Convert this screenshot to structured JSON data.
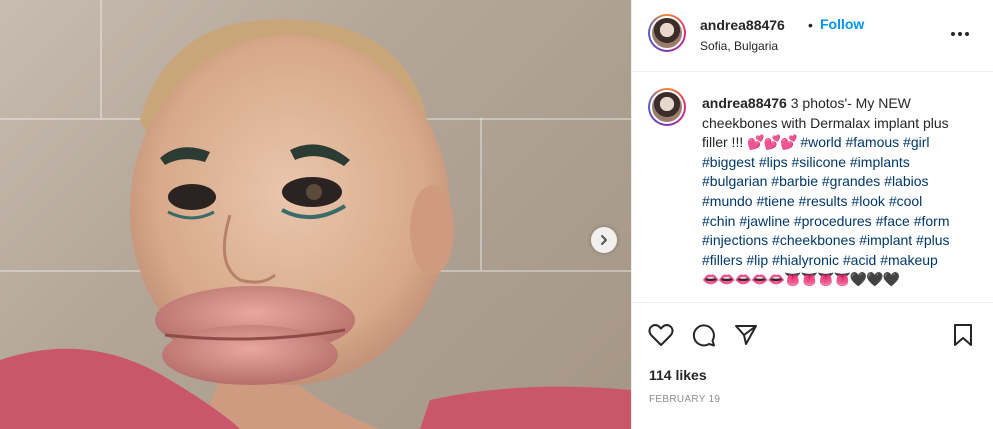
{
  "post": {
    "username": "andrea88476",
    "follow_label": "Follow",
    "separator": "•",
    "location": "Sofia, Bulgaria",
    "caption": {
      "username": "andrea88476",
      "text_before_tags": " 3 photos'- My NEW cheekbones with Dermalax implant plus filler !!! ",
      "emojis_inline": "💕💕💕",
      "hashtags": [
        "#world",
        "#famous",
        "#girl",
        "#biggest",
        "#lips",
        "#silicone",
        "#implants",
        "#bulgarian",
        "#barbie",
        "#grandes",
        "#labios",
        "#mundo",
        "#tiene",
        "#results",
        "#look",
        "#cool",
        "#chin",
        "#jawline",
        "#procedures",
        "#face",
        "#form",
        "#injections",
        "#cheekbones",
        "#implant",
        "#plus",
        "#fillers",
        "#lip",
        "#hialyronic",
        "#acid",
        "#makeup"
      ],
      "emojis_trailing": "👄👄👄👄👄👅👅👅👅🖤🖤🖤"
    },
    "likes_text": "114 likes",
    "date_text": "February 19"
  },
  "icons": {
    "header_more": "more-horizontal-icon",
    "next": "chevron-right-icon",
    "like": "heart-icon",
    "comment": "comment-icon",
    "share": "send-icon",
    "save": "bookmark-icon"
  },
  "colors": {
    "accent": "#0095f6",
    "hashtag": "#00376b",
    "text": "#262626",
    "muted": "#8e8e8e"
  }
}
